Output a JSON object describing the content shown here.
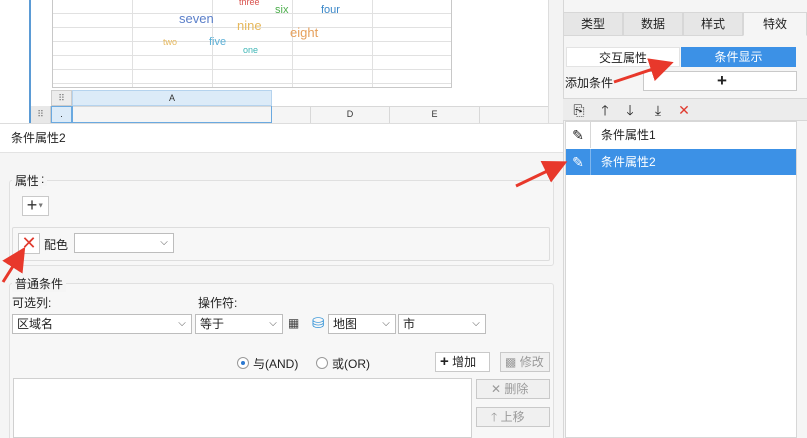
{
  "spreadsheet": {
    "words": [
      {
        "text": "three",
        "color": "#d9534f"
      },
      {
        "text": "six",
        "color": "#4cae4c"
      },
      {
        "text": "four",
        "color": "#3a87c8"
      },
      {
        "text": "seven",
        "color": "#5b7fc9"
      },
      {
        "text": "nine",
        "color": "#e6b85c"
      },
      {
        "text": "eight",
        "color": "#e6a05c"
      },
      {
        "text": "two",
        "color": "#e6b85c"
      },
      {
        "text": "five",
        "color": "#5bafd6"
      },
      {
        "text": "one",
        "color": "#3fb6b6"
      }
    ],
    "column_a": "A",
    "column_d": "D",
    "column_e": "E",
    "selected_row": "."
  },
  "dialog": {
    "title": "条件属性2",
    "attributes_legend": "属性",
    "color_label": "配色",
    "color_value": "",
    "normal_condition_legend": "普通条件",
    "optional_columns_label": "可选列:",
    "operator_label": "操作符:",
    "column_value": "区域名",
    "operator_value": "等于",
    "map_value": "地图",
    "city_value": "市",
    "and_label": "与(AND)",
    "or_label": "或(OR)",
    "add_label": "增加",
    "modify_label": "修改",
    "delete_label": "删除",
    "move_up_label": "上移"
  },
  "right_panel": {
    "tabs": [
      "类型",
      "数据",
      "样式",
      "特效"
    ],
    "active_tab": "特效",
    "segment_left": "交互属性",
    "segment_right": "条件显示",
    "add_condition_label": "添加条件",
    "add_condition_button": "+",
    "list_items": [
      "条件属性1",
      "条件属性2"
    ],
    "selected_index": 1
  },
  "colors": {
    "accent": "#3c91e6",
    "danger": "#e03a2e",
    "arrow": "#e8382b"
  }
}
